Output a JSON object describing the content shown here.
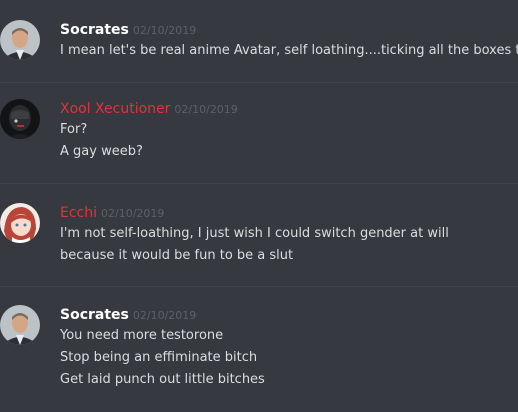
{
  "messages": [
    {
      "username": "Socrates",
      "timestamp": "02/10/2019",
      "lines": [
        "I mean let's be real anime Avatar, self loathing....ticking all the boxes there"
      ],
      "avatar_icon": "man-in-suit-avatar",
      "name_color": "#ffffff"
    },
    {
      "username": "Xool Xecutioner",
      "timestamp": "02/10/2019",
      "lines": [
        "For?",
        "A gay weeb?"
      ],
      "avatar_icon": "dark-masked-avatar",
      "name_color": "#e3323a"
    },
    {
      "username": "Ecchi",
      "timestamp": "02/10/2019",
      "lines": [
        "I'm not self-loathing, I just wish I could switch gender at will",
        "because it would be fun to be a slut"
      ],
      "avatar_icon": "anime-girl-avatar",
      "name_color": "#e3323a"
    },
    {
      "username": "Socrates",
      "timestamp": "02/10/2019",
      "lines": [
        "You need more testorone",
        "Stop being an effiminate bitch",
        "Get laid punch out little bitches"
      ],
      "avatar_icon": "man-in-suit-avatar",
      "name_color": "#ffffff"
    }
  ]
}
